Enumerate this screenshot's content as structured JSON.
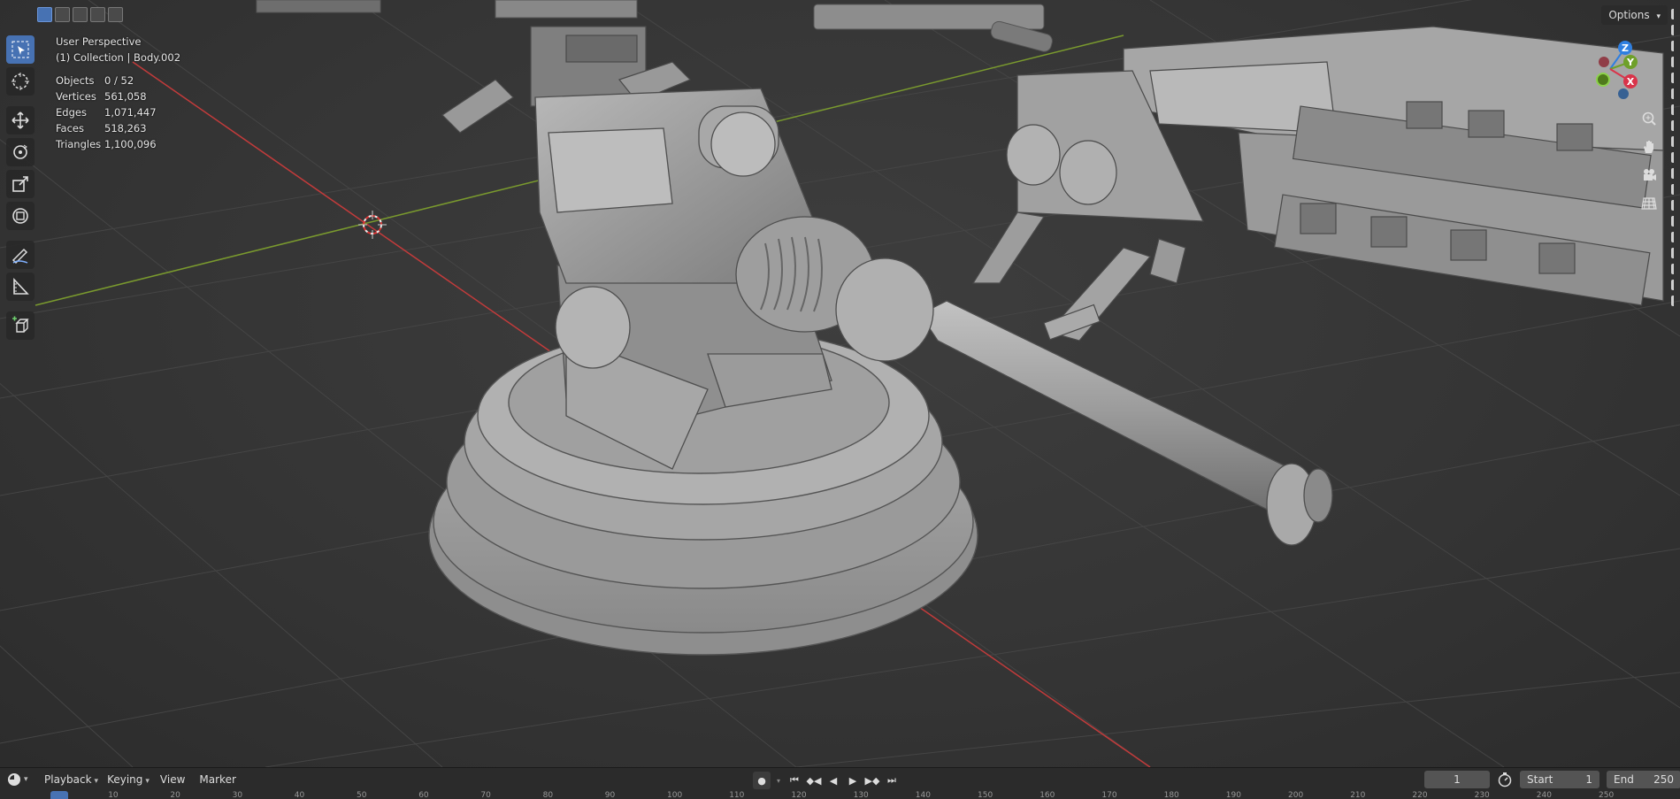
{
  "header": {
    "select_modes": [
      "select-box-icon",
      "select-extend-icon",
      "select-subtract-icon",
      "select-invert-icon",
      "select-intersect-icon"
    ],
    "options_label": "Options"
  },
  "overlay": {
    "view_name": "User Perspective",
    "collection": "(1) Collection | Body.002",
    "stats": [
      {
        "label": "Objects",
        "value": "0 / 52"
      },
      {
        "label": "Vertices",
        "value": "561,058"
      },
      {
        "label": "Edges",
        "value": "1,071,447"
      },
      {
        "label": "Faces",
        "value": "518,263"
      },
      {
        "label": "Triangles",
        "value": "1,100,096"
      }
    ]
  },
  "toolbar": {
    "tools": [
      "select-box-icon",
      "cursor-icon",
      "move-icon",
      "rotate-icon",
      "scale-icon",
      "transform-icon",
      "annotate-icon",
      "measure-icon",
      "add-cube-icon"
    ]
  },
  "gizmo": {
    "axes": [
      {
        "label": "Z",
        "color": "#2f7fe0"
      },
      {
        "label": "Y",
        "color": "#6fa02a"
      },
      {
        "label": "X",
        "color": "#d9344a"
      }
    ]
  },
  "nav": [
    "zoom-icon",
    "hand-icon",
    "camera-icon",
    "grid-icon"
  ],
  "timeline": {
    "menus": [
      "Playback",
      "Keying",
      "View",
      "Marker"
    ],
    "current_frame": "1",
    "start_label": "Start",
    "start_value": "1",
    "end_label": "End",
    "end_value": "250",
    "ruler_ticks": [
      "1",
      "10",
      "20",
      "30",
      "40",
      "50",
      "60",
      "70",
      "80",
      "90",
      "100",
      "110",
      "120",
      "130",
      "140",
      "150",
      "160",
      "170",
      "180",
      "190",
      "200",
      "210",
      "220",
      "230",
      "240",
      "250"
    ]
  },
  "colors": {
    "accent": "#4772b3",
    "x_axis": "#c23b3b",
    "y_axis": "#7a9a2e"
  }
}
